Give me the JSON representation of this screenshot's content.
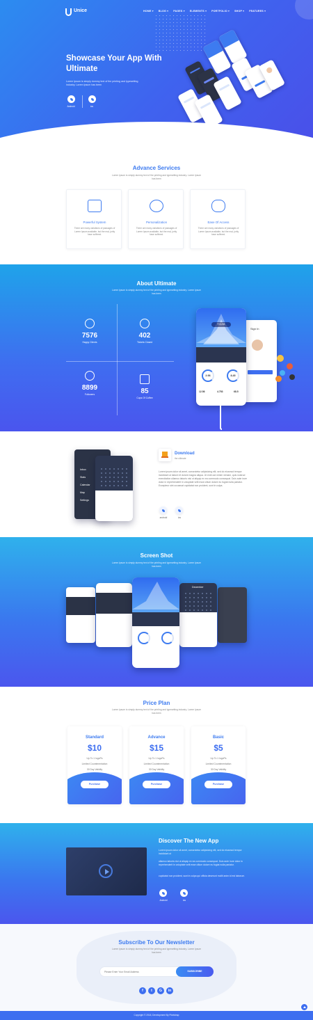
{
  "nav": {
    "brand": "Unice",
    "items": [
      "HOME ▾",
      "BLOG ▾",
      "PAGES ▾",
      "ELEMENTS ▾",
      "PORTFOLIO ▾",
      "SHOP ▾",
      "FEATURES ▾"
    ]
  },
  "hero": {
    "title": "Showcase Your App With Ultimate",
    "desc": "Lorem Ipsum is simply dummy text of the printing and typesetting industry. Lorem Ipsum has been",
    "android_label": "Android",
    "ios_label": "ios"
  },
  "services": {
    "title": "Advance Services",
    "sub": "Lorem Ipsum is simply dummy text of the printing and typesetting industry. Lorem Ipsum has been",
    "cards": [
      {
        "title": "Powerful System",
        "desc": "There are many variations of passages of Lorem Ipsum available, but the mal, jority have suffered.",
        "icon": "grid-icon"
      },
      {
        "title": "Personalization",
        "desc": "There are many variations of passages of Lorem Ipsum available, but the mal, jority have suffered.",
        "icon": "anchor-icon"
      },
      {
        "title": "Ease Of Access",
        "desc": "There are many variations of passages of Lorem Ipsum available, but the mal, jority have suffered.",
        "icon": "gamepad-icon"
      }
    ]
  },
  "about": {
    "title": "About Ultimate",
    "sub": "Lorem Ipsum is simply dummy text of the printing and typesetting industry. Lorem Ipsum has been",
    "stats": [
      {
        "num": "7576",
        "label": "Happy Clients"
      },
      {
        "num": "402",
        "label": "Tickets Closed"
      },
      {
        "num": "8899",
        "label": "Followers"
      },
      {
        "num": "85",
        "label": "Cups Of Coffee"
      }
    ],
    "phone": {
      "badge": "₹ 8,245",
      "v1": "2:56",
      "v2": "8.45",
      "f1": "12.56",
      "f2": "4.753",
      "f3": "68.5",
      "signin": "Sign In"
    }
  },
  "download": {
    "title": "Download",
    "sub": "the ultimate",
    "desc": "Lorem ipsum dolor sit amet, consectetur adipisicing elit, sed do eiusmod tempor incididunt ut labore et dolore magna aliqua. Ut enim ad minim veniam, quis nostrud exercitation ullamco laboris nisi ut aliquip ex ea commodo consequat. Duis aute irure dolor in reprehenderit in voluptate velit esse cillum dolore eu fugiat nulla pariatur. Excepteur sint occaecat cupidatat non proident, sunt in culpa.",
    "android_label": "android",
    "ios_label": "ios",
    "menu": [
      "Inbox",
      "Stats",
      "Calendar",
      "Map",
      "Settings"
    ]
  },
  "screens": {
    "title": "Screen Shot",
    "sub": "Lorem Ipsum is simply dummy text of the printing and typesetting industry. Lorem Ipsum has been",
    "month": "December"
  },
  "pricing": {
    "title": "Price Plan",
    "sub": "Lorem Ipsum is simply dummy text of the printing and typesetting industry. Lorem Ipsum has been",
    "plans": [
      {
        "name": "Standard",
        "price": "$10",
        "features": [
          "Up To 1 logoPs",
          "Limited Countenentation",
          "30 Day Validity"
        ],
        "button": "Purchase"
      },
      {
        "name": "Advance",
        "price": "$15",
        "features": [
          "Up To 1 logoPs",
          "Limited Countenentation",
          "30 Day Validity"
        ],
        "button": "Purchase"
      },
      {
        "name": "Basic",
        "price": "$5",
        "features": [
          "Up To 1 logoPs",
          "Limited Countenentation",
          "30 Day Validity"
        ],
        "button": "Purchase"
      }
    ]
  },
  "discover": {
    "title": "Discover The New App",
    "p1": "Lorem ipsum dolor sit amet, consectetur adipisicing elit, sed do eiusmod tempor incididunt ut",
    "p2": "ullamco laboris nisi ut aliquip ex ea commodo consequat. Duis aute irure dolor in reprehenderit in voluptate velit esse cillum dolore eu fugiat nulla pariatur.",
    "p3": "cupidatat non proident, sunt in culpa qui officia deserunt mollit anim id est laborum.",
    "android_label": "Android",
    "ios_label": "ios"
  },
  "newsletter": {
    "title": "Subscribe To Our Newsletter",
    "sub": "Lorem Ipsum is simply dummy text of the printing and typesetting industry. Lorem Ipsum has been",
    "placeholder": "Please Enter Your Email Address",
    "button": "SUBSCRIBE",
    "socials": [
      "f",
      "t",
      "G",
      "in"
    ]
  },
  "footer": {
    "copyright": "Copyright © 2018, Development By Pixelstrap"
  },
  "colors": {
    "accent": "#3d6ef0",
    "gradient_top": "#1fa3ea",
    "gradient_bottom": "#4a55ee"
  }
}
